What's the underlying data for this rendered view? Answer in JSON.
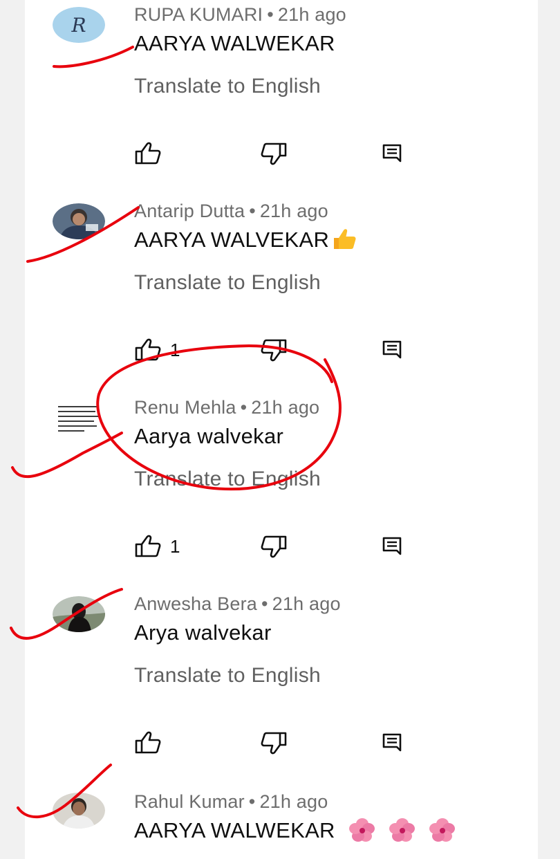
{
  "colors": {
    "page_bg": "#f1f1f1",
    "panel_bg": "#ffffff",
    "meta_text": "#6d6d6d",
    "comment_text": "#0f0f0f",
    "translate_text": "#606060",
    "annotation_red": "#e8000d"
  },
  "comments": [
    {
      "author": "RUPA KUMARI",
      "separator": "•",
      "time": "21h ago",
      "text": "AARYA WALWEKAR",
      "translate_label": "Translate to English",
      "like_count": "",
      "avatar_icon": "letter-r-avatar",
      "avatar_letter": "R",
      "emoji": ""
    },
    {
      "author": "Antarip Dutta",
      "separator": "•",
      "time": "21h ago",
      "text": "AARYA WALVEKAR",
      "translate_label": "Translate to English",
      "like_count": "1",
      "avatar_icon": "photo-avatar",
      "emoji": "thumbs-up-emoji"
    },
    {
      "author": "Renu Mehla",
      "separator": "•",
      "time": "21h ago",
      "text": "Aarya walvekar",
      "translate_label": "Translate to English",
      "like_count": "1",
      "avatar_icon": "text-image-avatar",
      "emoji": ""
    },
    {
      "author": "Anwesha Bera",
      "separator": "•",
      "time": "21h ago",
      "text": "Arya walvekar",
      "translate_label": "Translate to English",
      "like_count": "",
      "avatar_icon": "photo-avatar",
      "emoji": ""
    },
    {
      "author": "Rahul Kumar",
      "separator": "•",
      "time": "21h ago",
      "text": "AARYA WALWEKAR",
      "translate_label": "",
      "like_count": "",
      "avatar_icon": "photo-avatar",
      "emoji": "pink-flower-emoji x3"
    }
  ],
  "icons": {
    "like": "thumb-up-icon",
    "dislike": "thumb-down-icon",
    "reply": "comment-reply-icon"
  }
}
